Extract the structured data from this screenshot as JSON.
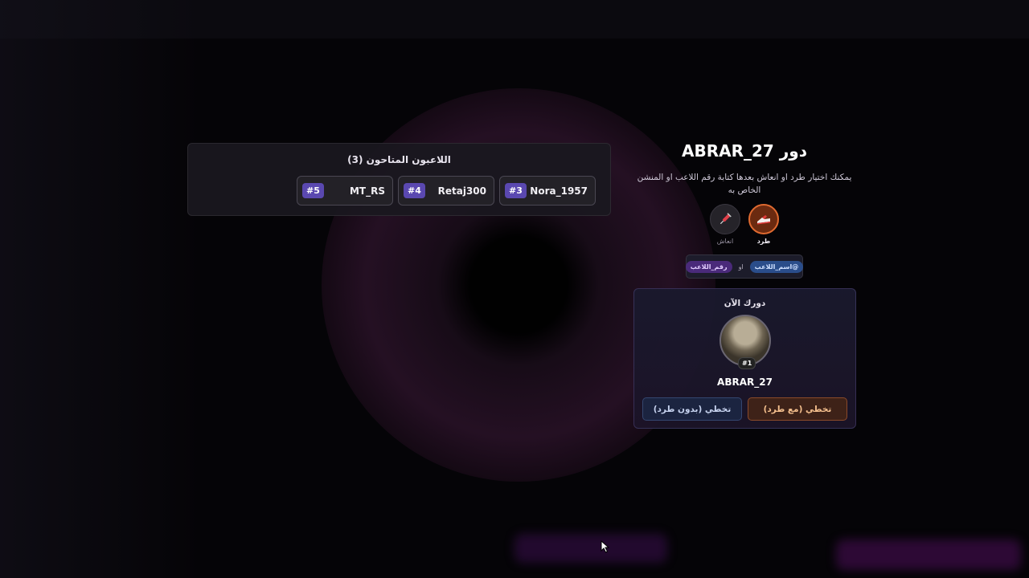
{
  "available_players": {
    "title": "اللاعبون المتاحون (3)",
    "players": [
      {
        "badge": "#3",
        "name": "Nora_1957"
      },
      {
        "badge": "#4",
        "name": "Retaj300"
      },
      {
        "badge": "#5",
        "name": "MT_RS"
      }
    ]
  },
  "turn": {
    "title": "دور ABRAR_27",
    "description": "يمكنك اختيار طرد او انعاش بعدها كتابة رقم اللاعب او المنشن الخاص به",
    "actions": {
      "kick_label": "طرد",
      "kick_icon": "kick-shoe-icon",
      "revive_label": "انعاش",
      "revive_icon": "syringe-icon"
    },
    "hint": {
      "name_tag": "@اسم_اللاعب",
      "or_label": "او",
      "number_tag": "رقم_اللاعب"
    }
  },
  "current_turn_card": {
    "title": "دورك الآن",
    "avatar_badge": "#1",
    "player_name": "ABRAR_27",
    "skip_with_kick_label": "تخطي (مع طرد)",
    "skip_without_kick_label": "تخطي (بدون طرد)"
  },
  "colors": {
    "kick_accent": "#e06a30",
    "badge_purple": "#5a48b0",
    "name_tag": "#2a4d8a",
    "number_tag": "#4a2a7a"
  }
}
